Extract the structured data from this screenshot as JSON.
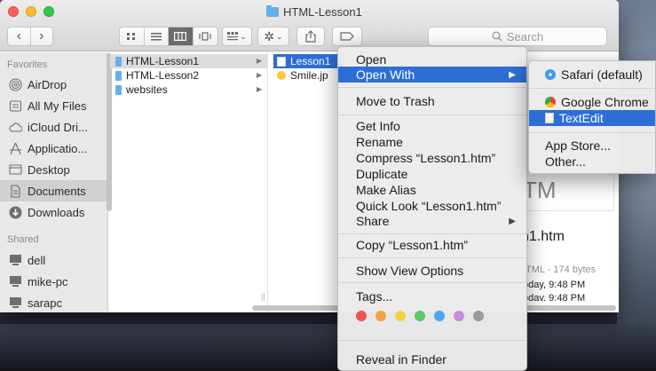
{
  "window": {
    "title": "HTML-Lesson1"
  },
  "toolbar": {
    "back": "‹",
    "forward": "›",
    "search_placeholder": "Search"
  },
  "sidebar": {
    "favorites_header": "Favorites",
    "shared_header": "Shared",
    "favorites": [
      {
        "label": "AirDrop",
        "icon": "airdrop-icon"
      },
      {
        "label": "All My Files",
        "icon": "all-files-icon"
      },
      {
        "label": "iCloud Dri...",
        "icon": "cloud-icon"
      },
      {
        "label": "Applicatio...",
        "icon": "applications-icon"
      },
      {
        "label": "Desktop",
        "icon": "desktop-icon"
      },
      {
        "label": "Documents",
        "icon": "documents-icon"
      },
      {
        "label": "Downloads",
        "icon": "downloads-icon"
      }
    ],
    "shared": [
      {
        "label": "dell",
        "icon": "computer-icon"
      },
      {
        "label": "mike-pc",
        "icon": "computer-icon"
      },
      {
        "label": "sarapc",
        "icon": "computer-icon"
      }
    ]
  },
  "columns": {
    "col1": [
      "HTML-Lesson1",
      "HTML-Lesson2",
      "websites"
    ],
    "col2": [
      "Lesson1",
      "Smile.jp"
    ]
  },
  "preview": {
    "kind": "TM",
    "name": "n1.htm",
    "type_size": "ITML - 174 bytes",
    "created": "oday, 9:48 PM",
    "modified": "odav. 9:48 PM"
  },
  "context_menu": {
    "open": "Open",
    "open_with": "Open With",
    "move_to_trash": "Move to Trash",
    "get_info": "Get Info",
    "rename": "Rename",
    "compress": "Compress “Lesson1.htm”",
    "duplicate": "Duplicate",
    "make_alias": "Make Alias",
    "quick_look": "Quick Look “Lesson1.htm”",
    "share": "Share",
    "copy": "Copy “Lesson1.htm”",
    "show_view_options": "Show View Options",
    "tags": "Tags...",
    "reveal": "Reveal in Finder",
    "tag_colors": [
      "#f05454",
      "#f5a14a",
      "#f6cf3f",
      "#5ccb5f",
      "#4aa6f2",
      "#c98ce2",
      "#9b9b9b"
    ]
  },
  "submenu": {
    "safari": "Safari (default)",
    "chrome": "Google Chrome",
    "textedit": "TextEdit",
    "app_store": "App Store...",
    "other": "Other..."
  },
  "colors": {
    "selection": "#2d6ed6",
    "folder": "#5fb0f0"
  }
}
